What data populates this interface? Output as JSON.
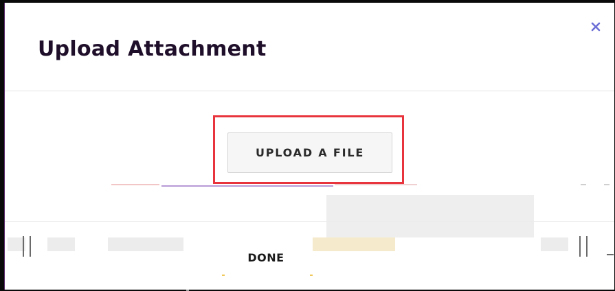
{
  "modal": {
    "title": "Upload Attachment",
    "close_icon": "close-icon",
    "upload_button_label": "UPLOAD A FILE",
    "done_button_label": "DONE"
  },
  "colors": {
    "highlight_border": "#e8343c",
    "close_icon": "#6b6fd6",
    "title_text": "#1f0f2a"
  }
}
